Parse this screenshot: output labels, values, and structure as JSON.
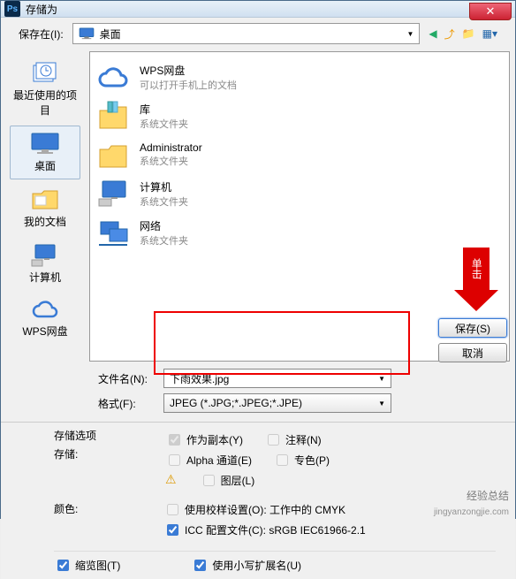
{
  "window": {
    "title": "存储为"
  },
  "toolbar": {
    "save_in_label": "保存在(I):",
    "location": "桌面"
  },
  "sidebar": {
    "items": [
      {
        "label": "最近使用的项目"
      },
      {
        "label": "桌面"
      },
      {
        "label": "我的文档"
      },
      {
        "label": "计算机"
      },
      {
        "label": "WPS网盘"
      }
    ]
  },
  "files": [
    {
      "name": "WPS网盘",
      "sub": "可以打开手机上的文档"
    },
    {
      "name": "库",
      "sub": "系统文件夹"
    },
    {
      "name": "Administrator",
      "sub": "系统文件夹"
    },
    {
      "name": "计算机",
      "sub": "系统文件夹"
    },
    {
      "name": "网络",
      "sub": "系统文件夹"
    }
  ],
  "form": {
    "filename_label": "文件名(N):",
    "filename_value": "下雨效果.jpg",
    "format_label": "格式(F):",
    "format_value": "JPEG (*.JPG;*.JPEG;*.JPE)",
    "save_btn": "保存(S)",
    "cancel_btn": "取消"
  },
  "callout": {
    "text": "单击"
  },
  "options": {
    "section_title": "存储选项",
    "storage_label": "存储:",
    "as_copy": "作为副本(Y)",
    "notes": "注释(N)",
    "alpha": "Alpha 通道(E)",
    "spot": "专色(P)",
    "layers": "图层(L)",
    "color_label": "颜色:",
    "proof": "使用校样设置(O): 工作中的 CMYK",
    "icc": "ICC 配置文件(C): sRGB IEC61966-2.1",
    "thumbnail": "缩览图(T)",
    "lowercase_ext": "使用小写扩展名(U)"
  },
  "watermark": {
    "main": "经验总结",
    "sub": "jingyanzongjie.com"
  }
}
